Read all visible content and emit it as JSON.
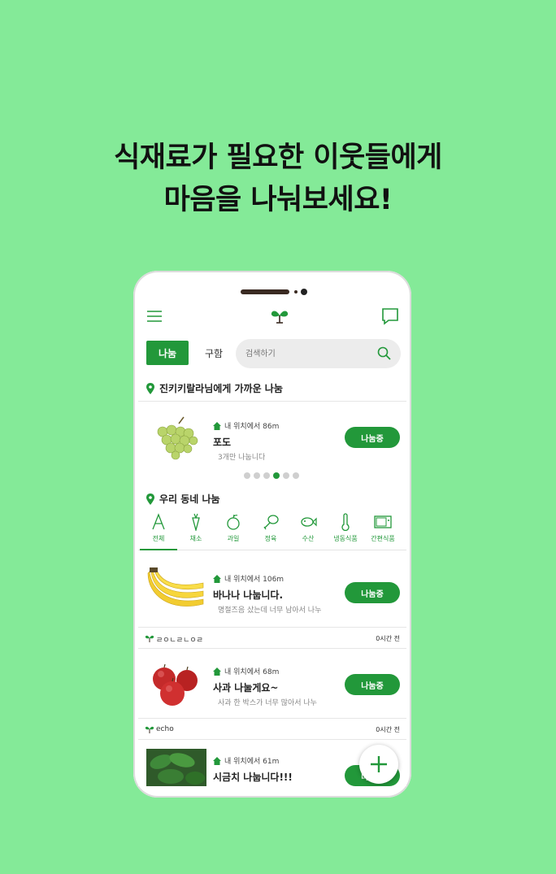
{
  "headline": {
    "line1": "식재료가 필요한 이웃들에게",
    "line2": "마음을 나눠보세요!"
  },
  "tabs": {
    "share_label": "나눔",
    "buy_label": "구함"
  },
  "search": {
    "placeholder": "검색하기"
  },
  "nearby": {
    "title": "진키키랄라님에게 가까운 나눔",
    "item": {
      "distance": "내 위치에서 86m",
      "title": "포도",
      "desc": "3개만 나눕니다",
      "button": "나눔중"
    },
    "pager_count": 6,
    "pager_active": 3
  },
  "neighborhood": {
    "title": "우리 동네 나눔"
  },
  "categories": [
    {
      "label": "전체",
      "icon": "all-icon"
    },
    {
      "label": "채소",
      "icon": "carrot-icon"
    },
    {
      "label": "과일",
      "icon": "fruit-icon"
    },
    {
      "label": "정육",
      "icon": "meat-icon"
    },
    {
      "label": "수산",
      "icon": "fish-icon"
    },
    {
      "label": "냉동식품",
      "icon": "thermometer-icon"
    },
    {
      "label": "간편식품",
      "icon": "microwave-icon"
    }
  ],
  "posts": [
    {
      "distance": "내 위치에서 106m",
      "title": "바나나 나눕니다.",
      "desc": "명절즈음 샀는데 너무 남아서 나누",
      "button": "나눔중",
      "user": "ㄹㅇㄴㄹㄴㅇㄹ",
      "time": "0시간 전"
    },
    {
      "distance": "내 위치에서 68m",
      "title": "사과 나눌게요~",
      "desc": "사과 한 박스가 너무 많아서 나누",
      "button": "나눔중",
      "user": "echo",
      "time": "0시간 전"
    },
    {
      "distance": "내 위치에서 61m",
      "title": "시금치 나눕니다!!!",
      "button": "나눔중"
    }
  ],
  "colors": {
    "background": "#84ea98",
    "accent": "#22983a"
  }
}
